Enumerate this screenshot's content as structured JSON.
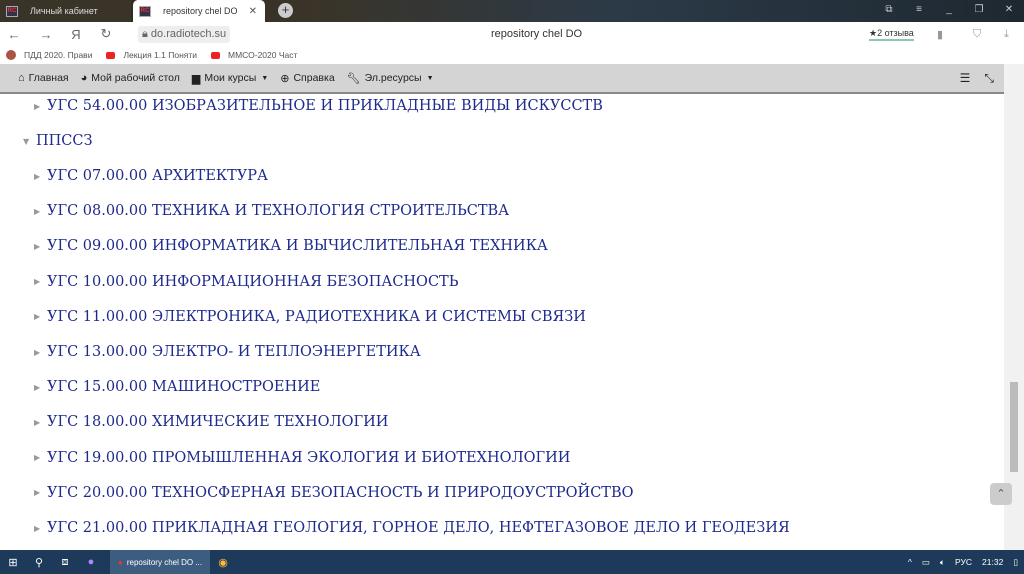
{
  "browser": {
    "tabs": [
      {
        "label": "Личный кабинет",
        "active": false
      },
      {
        "label": "repository chel DO",
        "active": true
      }
    ],
    "url": "do.radiotech.su",
    "page_title": "repository chel DO",
    "reviews": "2 отзыва",
    "bookmarks": [
      "ПДД 2020. Прави",
      "Лекция 1.1 Поняти",
      "ММСО-2020 Част"
    ]
  },
  "navbar": {
    "items": [
      {
        "label": "Главная",
        "icon": "home-icon"
      },
      {
        "label": "Мой рабочий стол",
        "icon": "dashboard-icon"
      },
      {
        "label": "Мои курсы",
        "icon": "briefcase-icon",
        "dropdown": true
      },
      {
        "label": "Справка",
        "icon": "lifebuoy-icon"
      },
      {
        "label": "Эл.ресурсы",
        "icon": "wrench-icon",
        "dropdown": true
      }
    ]
  },
  "tree": {
    "top_item": "УГС 54.00.00 ИЗОБРАЗИТЕЛЬНОЕ И ПРИКЛАДНЫЕ ВИДЫ ИСКУССТВ",
    "section": "ППССЗ",
    "items": [
      "УГС 07.00.00 АРХИТЕКТУРА",
      "УГС 08.00.00 ТЕХНИКА И ТЕХНОЛОГИЯ СТРОИТЕЛЬСТВА",
      "УГС 09.00.00 ИНФОРМАТИКА И ВЫЧИСЛИТЕЛЬНАЯ ТЕХНИКА",
      "УГС 10.00.00 ИНФОРМАЦИОННАЯ БЕЗОПАСНОСТЬ",
      "УГС 11.00.00 ЭЛЕКТРОНИКА, РАДИОТЕХНИКА И СИСТЕМЫ СВЯЗИ",
      "УГС 13.00.00 ЭЛЕКТРО- И ТЕПЛОЭНЕРГЕТИКА",
      "УГС 15.00.00 МАШИНОСТРОЕНИЕ",
      "УГС 18.00.00 ХИМИЧЕСКИЕ ТЕХНОЛОГИИ",
      "УГС 19.00.00 ПРОМЫШЛЕННАЯ ЭКОЛОГИЯ И БИОТЕХНОЛОГИИ",
      "УГС 20.00.00 ТЕХНОСФЕРНАЯ БЕЗОПАСНОСТЬ И ПРИРОДОУСТРОЙСТВО",
      "УГС 21.00.00 ПРИКЛАДНАЯ ГЕОЛОГИЯ, ГОРНОЕ ДЕЛО, НЕФТЕГАЗОВОЕ ДЕЛО И ГЕОДЕЗИЯ"
    ]
  },
  "taskbar": {
    "app": "repository chel DO ...",
    "lang": "РУС",
    "time": "21:32"
  },
  "colors": {
    "link": "#1e2a8c",
    "navbar": "#d4d4d4",
    "taskbar": "#1e3a5a"
  }
}
